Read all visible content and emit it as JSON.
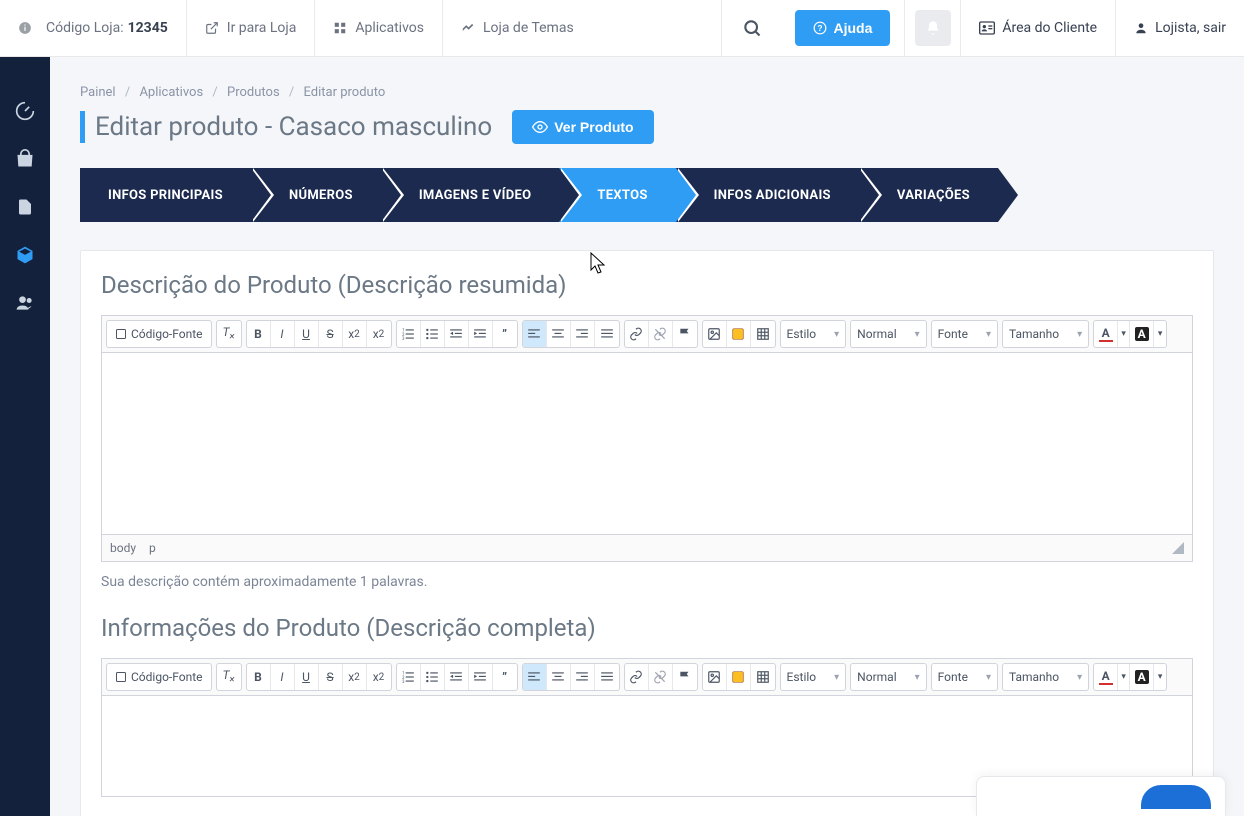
{
  "topbar": {
    "store_code_label": "Código Loja:",
    "store_code_value": "12345",
    "go_to_store": "Ir para Loja",
    "apps": "Aplicativos",
    "themes": "Loja de Temas",
    "help": "Ajuda",
    "client_area": "Área do Cliente",
    "shopkeeper_exit": "Lojista, sair"
  },
  "breadcrumb": {
    "painel": "Painel",
    "apps": "Aplicativos",
    "products": "Produtos",
    "edit": "Editar produto"
  },
  "page": {
    "title": "Editar produto - Casaco masculino",
    "view_product": "Ver Produto"
  },
  "steps": {
    "infos_principais": "INFOS PRINCIPAIS",
    "numeros": "NÚMEROS",
    "imagens_video": "IMAGENS E VÍDEO",
    "textos": "TEXTOS",
    "infos_adicionais": "INFOS ADICIONAIS",
    "variacoes": "VARIAÇÕES"
  },
  "section1": {
    "title": "Descrição do Produto (Descrição resumida)",
    "helper": "Sua descrição contém aproximadamente 1 palavras."
  },
  "section2": {
    "title": "Informações do Produto (Descrição completa)"
  },
  "toolbar": {
    "source": "Código-Fonte",
    "style": "Estilo",
    "format": "Normal",
    "font": "Fonte",
    "size": "Tamanho"
  },
  "editor_status": {
    "body": "body",
    "p": "p"
  }
}
